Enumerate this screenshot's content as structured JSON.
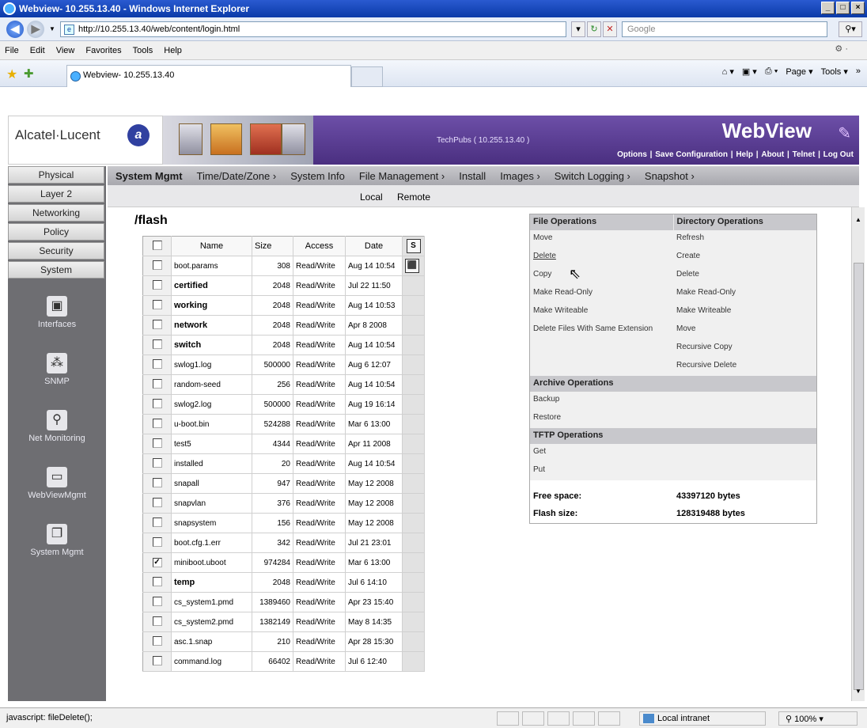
{
  "browser": {
    "window_title": "Webview- 10.255.13.40 - Windows Internet Explorer",
    "url": "http://10.255.13.40/web/content/login.html",
    "search_placeholder": "Google",
    "menu": [
      "File",
      "Edit",
      "View",
      "Favorites",
      "Tools",
      "Help"
    ],
    "tab_title": "Webview- 10.255.13.40",
    "commands": [
      "Page ▾",
      "Tools ▾"
    ],
    "status_text": "javascript: fileDelete();",
    "zone": "Local intranet",
    "zoom": "100%"
  },
  "app": {
    "brand": "Alcatel·Lucent",
    "title": "WebView",
    "device": "TechPubs ( 10.255.13.40 )",
    "header_links": [
      "Options",
      "Save Configuration",
      "Help",
      "About",
      "Telnet",
      "Log Out"
    ],
    "side_tabs": [
      "Physical",
      "Layer 2",
      "Networking",
      "Policy",
      "Security",
      "System"
    ],
    "side_icons": [
      {
        "label": "Interfaces",
        "icon": "interfaces-icon"
      },
      {
        "label": "SNMP",
        "icon": "snmp-icon"
      },
      {
        "label": "Net Monitoring",
        "icon": "net-monitoring-icon"
      },
      {
        "label": "WebViewMgmt",
        "icon": "webview-mgmt-icon"
      },
      {
        "label": "System Mgmt",
        "icon": "system-mgmt-icon"
      }
    ],
    "top_nav": [
      "System Mgmt",
      "Time/Date/Zone ›",
      "System Info",
      "File Management ›",
      "Install",
      "Images ›",
      "Switch Logging ›",
      "Snapshot ›"
    ],
    "sub_nav": [
      "Local",
      "Remote"
    ]
  },
  "files": {
    "path": "/flash",
    "columns": [
      "Name",
      "Size",
      "Access",
      "Date"
    ],
    "side_controls": [
      "S",
      "⬛"
    ],
    "rows": [
      {
        "name": "boot.params",
        "size": "308",
        "access": "Read/Write",
        "date": "Aug 14 10:54",
        "bold": false,
        "checked": false
      },
      {
        "name": "certified",
        "size": "2048",
        "access": "Read/Write",
        "date": "Jul 22 11:50",
        "bold": true,
        "checked": false
      },
      {
        "name": "working",
        "size": "2048",
        "access": "Read/Write",
        "date": "Aug 14 10:53",
        "bold": true,
        "checked": false
      },
      {
        "name": "network",
        "size": "2048",
        "access": "Read/Write",
        "date": "Apr 8 2008",
        "bold": true,
        "checked": false
      },
      {
        "name": "switch",
        "size": "2048",
        "access": "Read/Write",
        "date": "Aug 14 10:54",
        "bold": true,
        "checked": false
      },
      {
        "name": "swlog1.log",
        "size": "500000",
        "access": "Read/Write",
        "date": "Aug 6 12:07",
        "bold": false,
        "checked": false
      },
      {
        "name": "random-seed",
        "size": "256",
        "access": "Read/Write",
        "date": "Aug 14 10:54",
        "bold": false,
        "checked": false
      },
      {
        "name": "swlog2.log",
        "size": "500000",
        "access": "Read/Write",
        "date": "Aug 19 16:14",
        "bold": false,
        "checked": false
      },
      {
        "name": "u-boot.bin",
        "size": "524288",
        "access": "Read/Write",
        "date": "Mar 6 13:00",
        "bold": false,
        "checked": false
      },
      {
        "name": "test5",
        "size": "4344",
        "access": "Read/Write",
        "date": "Apr 11 2008",
        "bold": false,
        "checked": false
      },
      {
        "name": "installed",
        "size": "20",
        "access": "Read/Write",
        "date": "Aug 14 10:54",
        "bold": false,
        "checked": false
      },
      {
        "name": "snapall",
        "size": "947",
        "access": "Read/Write",
        "date": "May 12 2008",
        "bold": false,
        "checked": false
      },
      {
        "name": "snapvlan",
        "size": "376",
        "access": "Read/Write",
        "date": "May 12 2008",
        "bold": false,
        "checked": false
      },
      {
        "name": "snapsystem",
        "size": "156",
        "access": "Read/Write",
        "date": "May 12 2008",
        "bold": false,
        "checked": false
      },
      {
        "name": "boot.cfg.1.err",
        "size": "342",
        "access": "Read/Write",
        "date": "Jul 21 23:01",
        "bold": false,
        "checked": false
      },
      {
        "name": "miniboot.uboot",
        "size": "974284",
        "access": "Read/Write",
        "date": "Mar 6 13:00",
        "bold": false,
        "checked": true
      },
      {
        "name": "temp",
        "size": "2048",
        "access": "Read/Write",
        "date": "Jul 6 14:10",
        "bold": true,
        "checked": false
      },
      {
        "name": "cs_system1.pmd",
        "size": "1389460",
        "access": "Read/Write",
        "date": "Apr 23 15:40",
        "bold": false,
        "checked": false
      },
      {
        "name": "cs_system2.pmd",
        "size": "1382149",
        "access": "Read/Write",
        "date": "May 8 14:35",
        "bold": false,
        "checked": false
      },
      {
        "name": "asc.1.snap",
        "size": "210",
        "access": "Read/Write",
        "date": "Apr 28 15:30",
        "bold": false,
        "checked": false
      },
      {
        "name": "command.log",
        "size": "66402",
        "access": "Read/Write",
        "date": "Jul 6 12:40",
        "bold": false,
        "checked": false
      }
    ]
  },
  "operations": {
    "file_header": "File Operations",
    "dir_header": "Directory Operations",
    "rows": [
      [
        "Move",
        "Refresh"
      ],
      [
        "Delete",
        "Create"
      ],
      [
        "Copy",
        "Delete"
      ],
      [
        "Make Read-Only",
        "Make Read-Only"
      ],
      [
        "Make Writeable",
        "Make Writeable"
      ],
      [
        "Delete Files With Same Extension",
        "Move"
      ],
      [
        "",
        "Recursive Copy"
      ],
      [
        "",
        "Recursive Delete"
      ]
    ],
    "archive_header": "Archive Operations",
    "archive": [
      "Backup",
      "Restore"
    ],
    "tftp_header": "TFTP Operations",
    "tftp": [
      "Get",
      "Put"
    ],
    "free_space_label": "Free space:",
    "free_space_value": "43397120 bytes",
    "flash_size_label": "Flash size:",
    "flash_size_value": "128319488 bytes"
  }
}
